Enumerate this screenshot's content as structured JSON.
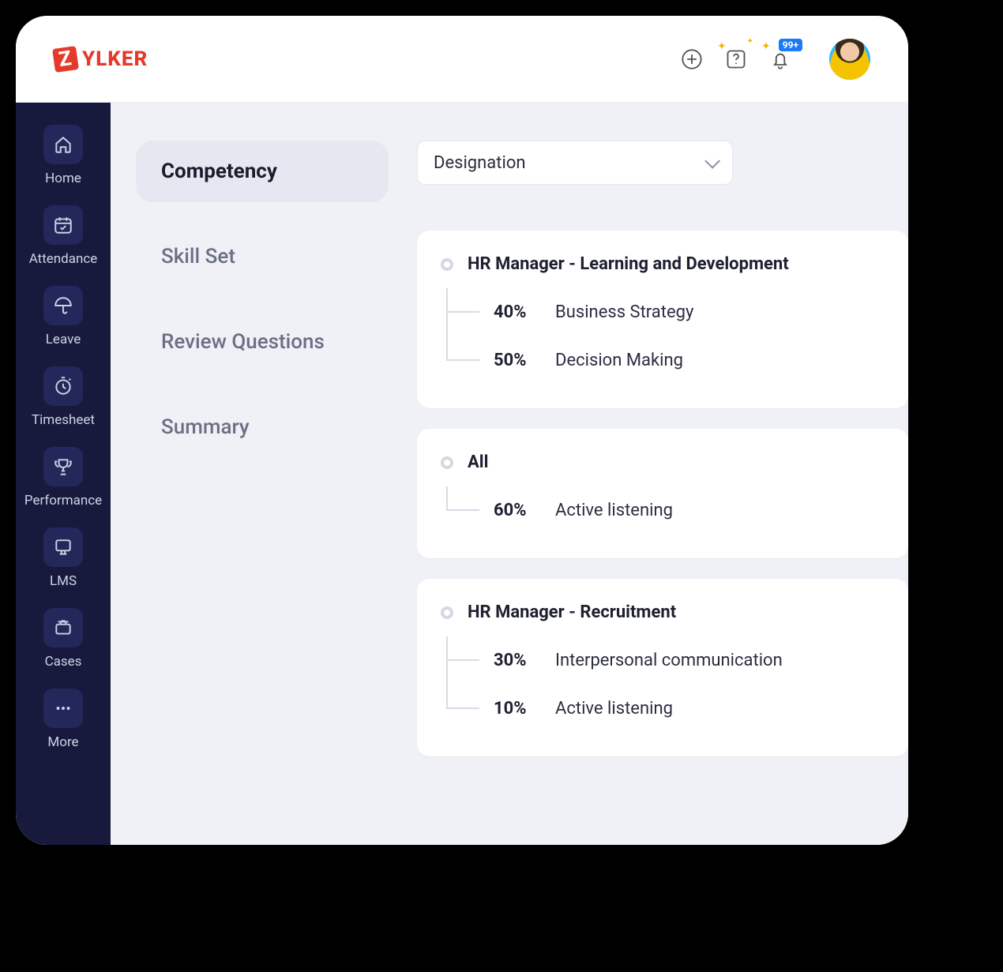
{
  "brand": {
    "logo_letter": "Z",
    "logo_text": "YLKER"
  },
  "topbar": {
    "notification_badge": "99+"
  },
  "sidebar": {
    "items": [
      {
        "label": "Home"
      },
      {
        "label": "Attendance"
      },
      {
        "label": "Leave"
      },
      {
        "label": "Timesheet"
      },
      {
        "label": "Performance"
      },
      {
        "label": "LMS"
      },
      {
        "label": "Cases"
      },
      {
        "label": "More"
      }
    ]
  },
  "tabs": [
    {
      "label": "Competency",
      "active": true
    },
    {
      "label": "Skill Set"
    },
    {
      "label": "Review Questions"
    },
    {
      "label": "Summary"
    }
  ],
  "filter": {
    "label": "Designation"
  },
  "groups": [
    {
      "title": "HR Manager - Learning and Development",
      "rows": [
        {
          "pct": "40%",
          "skill": "Business Strategy"
        },
        {
          "pct": "50%",
          "skill": "Decision Making"
        }
      ]
    },
    {
      "title": "All",
      "rows": [
        {
          "pct": "60%",
          "skill": "Active listening"
        }
      ]
    },
    {
      "title": "HR Manager - Recruitment",
      "rows": [
        {
          "pct": "30%",
          "skill": "Interpersonal communication"
        },
        {
          "pct": "10%",
          "skill": "Active listening"
        }
      ]
    }
  ]
}
